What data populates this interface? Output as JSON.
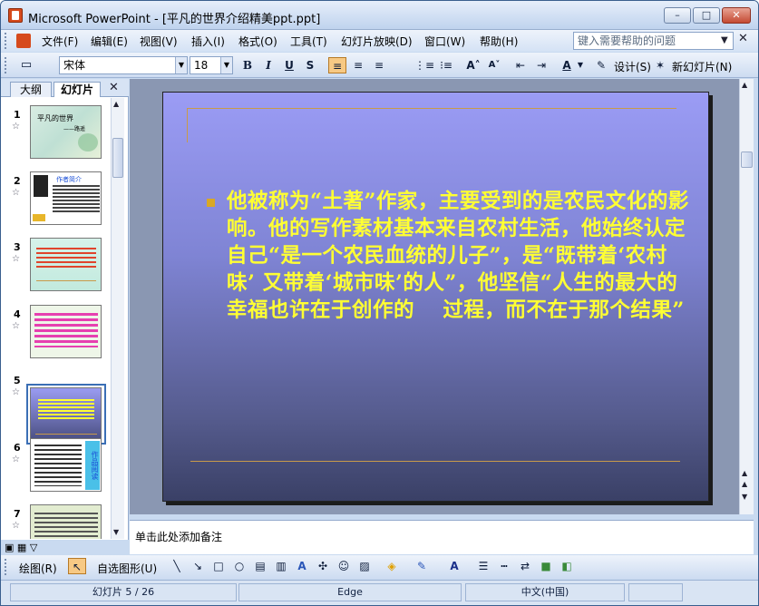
{
  "window": {
    "title": "Microsoft PowerPoint - [平凡的世界介绍精美ppt.ppt]",
    "min": "–",
    "max": "□",
    "close": "✕"
  },
  "menu": {
    "items": [
      "文件(F)",
      "编辑(E)",
      "视图(V)",
      "插入(I)",
      "格式(O)",
      "工具(T)",
      "幻灯片放映(D)",
      "窗口(W)",
      "帮助(H)"
    ],
    "help_placeholder": "键入需要帮助的问题"
  },
  "format_toolbar": {
    "font": "宋体",
    "size": "18",
    "bold": "B",
    "italic": "I",
    "underline": "U",
    "shadow": "S",
    "design": "设计(S)",
    "new_slide": "新幻灯片(N)"
  },
  "left_pane": {
    "tabs": [
      "大纲",
      "幻灯片"
    ],
    "close": "✕",
    "thumbs": [
      {
        "num": "1",
        "title": "平凡的世界",
        "sub": "——路遥"
      },
      {
        "num": "2",
        "title": "作者简介"
      },
      {
        "num": "3"
      },
      {
        "num": "4"
      },
      {
        "num": "5"
      },
      {
        "num": "6",
        "side": "作品阅读"
      },
      {
        "num": "7"
      }
    ]
  },
  "slide": {
    "body": "他被称为“土著”作家，主要受到的是农民文化的影响。他的写作素材基本来自农村生活，他始终认定自己“是一个农民血统的儿子”，是“既带着‘农村味’ 又带着‘城市味’的人”，他坚信“人生的最大的幸福也许在于创作的　 过程，而不在于那个结果”"
  },
  "notes": {
    "placeholder": "单击此处添加备注"
  },
  "draw_toolbar": {
    "draw": "绘图(R)",
    "autoshapes": "自选图形(U)"
  },
  "status": {
    "slide": "幻灯片 5 / 26",
    "design": "Edge",
    "language": "中文(中国)"
  },
  "colors": {
    "slide_text": "#ffff33",
    "accent_line": "#c89a4a",
    "bullet": "#d9a825"
  }
}
